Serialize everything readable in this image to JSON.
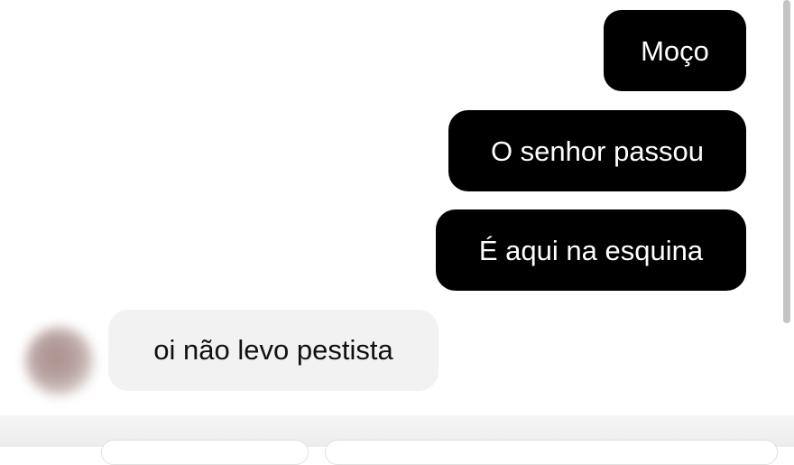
{
  "chat": {
    "messages": [
      {
        "direction": "outgoing",
        "text": "Moço"
      },
      {
        "direction": "outgoing",
        "text": "O senhor passou"
      },
      {
        "direction": "outgoing",
        "text": "É aqui na esquina"
      },
      {
        "direction": "incoming",
        "text": "oi não levo pestista"
      }
    ]
  },
  "colors": {
    "outgoing_bubble": "#000000",
    "outgoing_text": "#ffffff",
    "incoming_bubble": "#f2f2f2",
    "incoming_text": "#111111",
    "background": "#ffffff"
  },
  "icons": {
    "avatar": "blurred-avatar"
  }
}
